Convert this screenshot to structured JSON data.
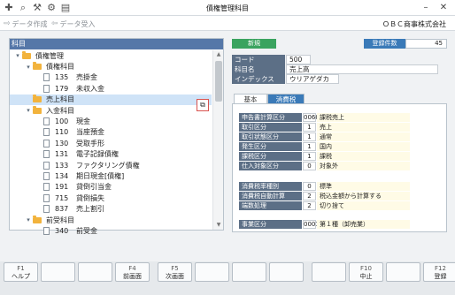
{
  "window": {
    "title": "債権管理科目",
    "company": "ＯＢＣ商事株式会社"
  },
  "toolbar": {
    "create_label": "データ作成",
    "import_label": "データ受入"
  },
  "tree": {
    "header": "科目",
    "items": [
      {
        "level": 0,
        "type": "folder",
        "code": "",
        "name": "債権管理",
        "expanded": true
      },
      {
        "level": 1,
        "type": "folder",
        "code": "",
        "name": "債権科目",
        "expanded": true
      },
      {
        "level": 2,
        "type": "doc",
        "code": "135",
        "name": "売掛金"
      },
      {
        "level": 2,
        "type": "doc",
        "code": "179",
        "name": "未収入金"
      },
      {
        "level": 1,
        "type": "folder",
        "code": "",
        "name": "売上科目",
        "selected": true
      },
      {
        "level": 1,
        "type": "folder",
        "code": "",
        "name": "入金科目",
        "expanded": true
      },
      {
        "level": 2,
        "type": "doc",
        "code": "100",
        "name": "現金"
      },
      {
        "level": 2,
        "type": "doc",
        "code": "110",
        "name": "当座預金"
      },
      {
        "level": 2,
        "type": "doc",
        "code": "130",
        "name": "受取手形"
      },
      {
        "level": 2,
        "type": "doc",
        "code": "131",
        "name": "電子記録債権"
      },
      {
        "level": 2,
        "type": "doc",
        "code": "133",
        "name": "ファクタリング債権"
      },
      {
        "level": 2,
        "type": "doc",
        "code": "134",
        "name": "期日現金[債権]"
      },
      {
        "level": 2,
        "type": "doc",
        "code": "191",
        "name": "貸倒引当金"
      },
      {
        "level": 2,
        "type": "doc",
        "code": "715",
        "name": "貸倒損失"
      },
      {
        "level": 2,
        "type": "doc",
        "code": "837",
        "name": "売上割引"
      },
      {
        "level": 1,
        "type": "folder",
        "code": "",
        "name": "前受科目",
        "expanded": true
      },
      {
        "level": 2,
        "type": "doc",
        "code": "340",
        "name": "前受金"
      }
    ]
  },
  "detail": {
    "status_badge": "新規",
    "count_label": "登録件数",
    "count_value": "45",
    "code_label": "コード",
    "code_value": "500",
    "name_label": "科目名",
    "name_value": "売上高",
    "index_label": "インデックス",
    "index_value": "ウリアゲダカ",
    "tabs": [
      "基本",
      "消費税"
    ],
    "group1": [
      {
        "label": "申告書計算区分",
        "code": "0060",
        "text": "課税売上"
      },
      {
        "label": "取引区分",
        "code": "1",
        "text": "売上"
      },
      {
        "label": "取引状態区分",
        "code": "1",
        "text": "通常"
      },
      {
        "label": "発生区分",
        "code": "1",
        "text": "国内"
      },
      {
        "label": "課税区分",
        "code": "1",
        "text": "課税"
      },
      {
        "label": "仕入対象区分",
        "code": "0",
        "text": "対象外"
      }
    ],
    "group2": [
      {
        "label": "消費税率種別",
        "code": "0",
        "text": "標準"
      },
      {
        "label": "消費税自動計算",
        "code": "2",
        "text": "税込金額から計算する"
      },
      {
        "label": "端数処理",
        "code": "2",
        "text": "切り捨て"
      }
    ],
    "group3": [
      {
        "label": "事業区分",
        "code": "0001",
        "text": "第１種（卸売業）"
      }
    ]
  },
  "fkeys": [
    {
      "key": "F1",
      "label": "ヘルプ"
    },
    {
      "key": "",
      "label": ""
    },
    {
      "key": "",
      "label": ""
    },
    {
      "key": "F4",
      "label": "前画面"
    },
    {
      "key": "F5",
      "label": "次画面"
    },
    {
      "key": "",
      "label": ""
    },
    {
      "key": "",
      "label": ""
    },
    {
      "key": "",
      "label": ""
    },
    {
      "key": "",
      "label": ""
    },
    {
      "key": "F10",
      "label": "中止"
    },
    {
      "key": "",
      "label": ""
    },
    {
      "key": "F12",
      "label": "登録"
    }
  ]
}
